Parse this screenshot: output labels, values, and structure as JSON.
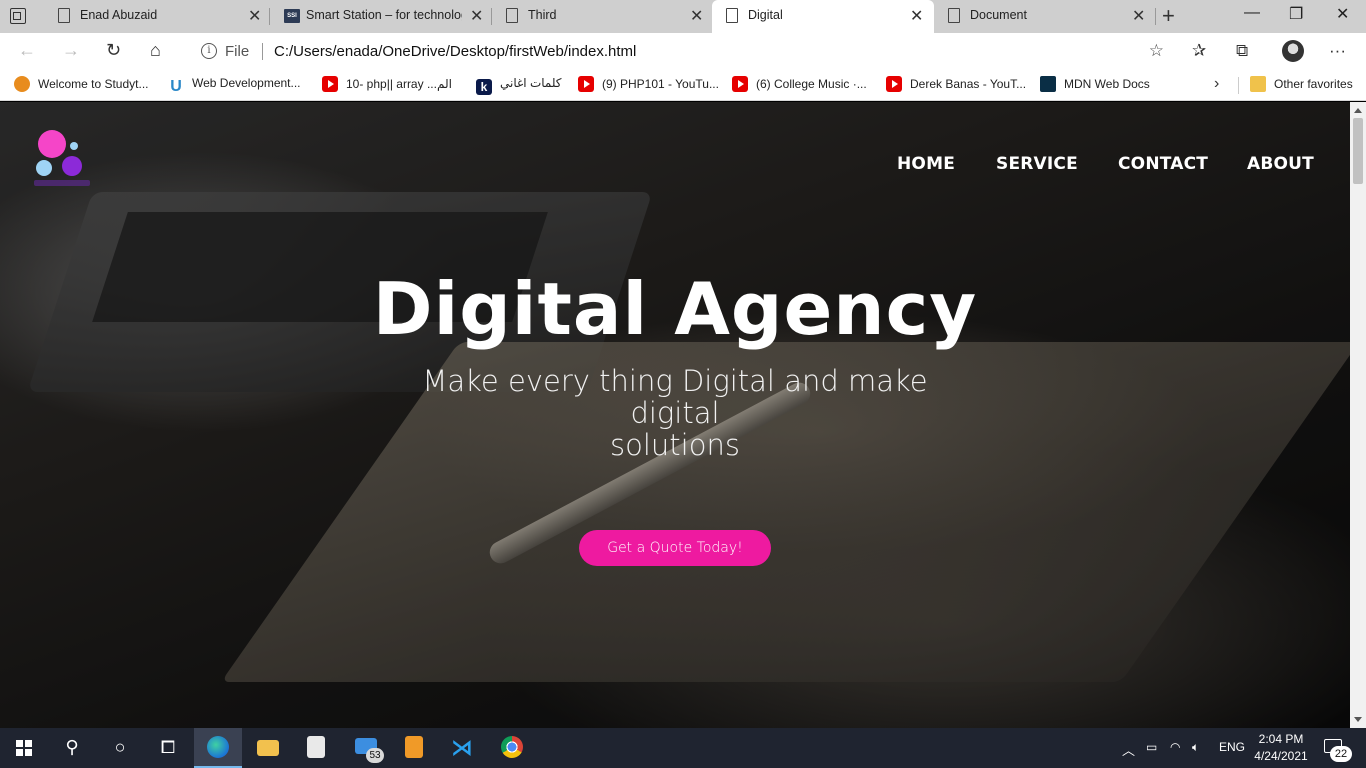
{
  "browser": {
    "tabs": [
      {
        "title": "Enad Abuzaid",
        "icon": "page-icon",
        "active": false
      },
      {
        "title": "Smart Station – for technolog",
        "icon": "smart-station-icon",
        "active": false
      },
      {
        "title": "Third",
        "icon": "page-icon",
        "active": false
      },
      {
        "title": "Digital",
        "icon": "page-icon",
        "active": true
      },
      {
        "title": "Document",
        "icon": "page-icon",
        "active": false
      }
    ],
    "new_tab": "+",
    "controls": {
      "minimize": "—",
      "maximize": "❐",
      "close": "✕"
    },
    "address": {
      "scheme": "File",
      "url": "C:/Users/enada/OneDrive/Desktop/firstWeb/index.html"
    },
    "favorites": [
      {
        "label": "Welcome to Studyt...",
        "icon": "studytonight-icon"
      },
      {
        "label": "Web Development...",
        "icon": "udemy-icon"
      },
      {
        "label": "10- php|| array ...الم",
        "icon": "youtube-icon"
      },
      {
        "label": "كلمات اغاني",
        "icon": "k-icon"
      },
      {
        "label": "(9) PHP101 - YouTu...",
        "icon": "youtube-icon"
      },
      {
        "label": "(6) College Music ·...",
        "icon": "youtube-icon"
      },
      {
        "label": "Derek Banas - YouT...",
        "icon": "youtube-icon"
      },
      {
        "label": "MDN Web Docs",
        "icon": "mdn-icon"
      }
    ],
    "other_favorites": "Other favorites"
  },
  "page": {
    "nav": [
      "HOME",
      "SERVICE",
      "CONTACT",
      "ABOUT"
    ],
    "hero_title": "Digital Agency",
    "hero_subtitle_line1": "Make every thing Digital and make digital",
    "hero_subtitle_line2": "solutions",
    "cta_label": "Get a Quote Today!",
    "accent_color": "#ee1aa0"
  },
  "taskbar": {
    "mail_badge": "53",
    "language": "ENG",
    "time": "2:04 PM",
    "date": "4/24/2021",
    "notifications": "22"
  }
}
